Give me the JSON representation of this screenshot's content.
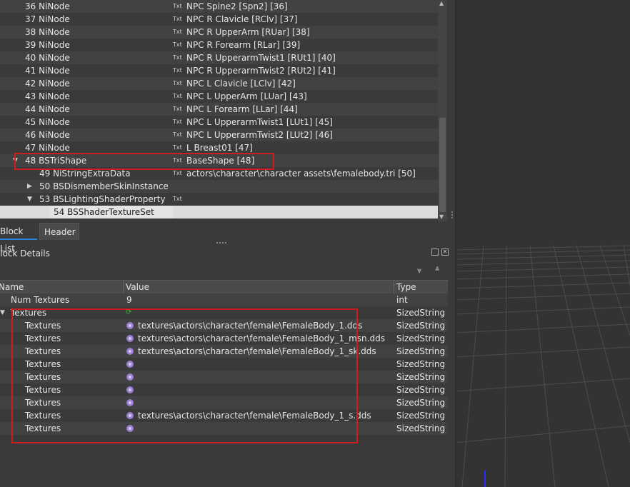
{
  "tree": {
    "rows": [
      {
        "num": "36",
        "type": "NiNode",
        "has_txt": true,
        "value": "NPC Spine2 [Spn2] [36]"
      },
      {
        "num": "37",
        "type": "NiNode",
        "has_txt": true,
        "value": "NPC R Clavicle [RClv] [37]"
      },
      {
        "num": "38",
        "type": "NiNode",
        "has_txt": true,
        "value": "NPC R UpperArm [RUar] [38]"
      },
      {
        "num": "39",
        "type": "NiNode",
        "has_txt": true,
        "value": "NPC R Forearm [RLar] [39]"
      },
      {
        "num": "40",
        "type": "NiNode",
        "has_txt": true,
        "value": "NPC R UpperarmTwist1 [RUt1] [40]"
      },
      {
        "num": "41",
        "type": "NiNode",
        "has_txt": true,
        "value": "NPC R UpperarmTwist2 [RUt2] [41]"
      },
      {
        "num": "42",
        "type": "NiNode",
        "has_txt": true,
        "value": "NPC L Clavicle [LClv] [42]"
      },
      {
        "num": "43",
        "type": "NiNode",
        "has_txt": true,
        "value": "NPC L UpperArm [LUar] [43]"
      },
      {
        "num": "44",
        "type": "NiNode",
        "has_txt": true,
        "value": "NPC L Forearm [LLar] [44]"
      },
      {
        "num": "45",
        "type": "NiNode",
        "has_txt": true,
        "value": "NPC L UpperarmTwist1 [LUt1] [45]"
      },
      {
        "num": "46",
        "type": "NiNode",
        "has_txt": true,
        "value": "NPC L UpperarmTwist2 [LUt2] [46]"
      },
      {
        "num": "47",
        "type": "NiNode",
        "has_txt": true,
        "value": "L Breast01 [47]"
      },
      {
        "num": "48",
        "type": "BSTriShape",
        "has_txt": true,
        "value": "BaseShape [48]"
      },
      {
        "num": "49",
        "type": "NiStringExtraData",
        "has_txt": true,
        "value": "actors\\character\\character assets\\femalebody.tri [50]"
      },
      {
        "num": "50",
        "type": "BSDismemberSkinInstance",
        "has_txt": false,
        "value": ""
      },
      {
        "num": "53",
        "type": "BSLightingShaderProperty",
        "has_txt": true,
        "value": ""
      },
      {
        "num": "54",
        "type": "BSShaderTextureSet",
        "has_txt": false,
        "value": ""
      }
    ],
    "txt_icon": "Txt"
  },
  "tabs": {
    "block_list": "Block List",
    "header": "Header"
  },
  "block_details": {
    "title": "Block Details",
    "columns": {
      "name": "Name",
      "value": "Value",
      "type": "Type"
    },
    "rows": [
      {
        "name": "Num Textures",
        "value": "9",
        "type": "int"
      },
      {
        "name": "Textures",
        "value": "",
        "type": "SizedString"
      },
      {
        "name": "Textures",
        "value": "textures\\actors\\character\\female\\FemaleBody_1.dds",
        "type": "SizedString"
      },
      {
        "name": "Textures",
        "value": "textures\\actors\\character\\female\\FemaleBody_1_msn.dds",
        "type": "SizedString"
      },
      {
        "name": "Textures",
        "value": "textures\\actors\\character\\female\\FemaleBody_1_sk.dds",
        "type": "SizedString"
      },
      {
        "name": "Textures",
        "value": "",
        "type": "SizedString"
      },
      {
        "name": "Textures",
        "value": "",
        "type": "SizedString"
      },
      {
        "name": "Textures",
        "value": "",
        "type": "SizedString"
      },
      {
        "name": "Textures",
        "value": "",
        "type": "SizedString"
      },
      {
        "name": "Textures",
        "value": "textures\\actors\\character\\female\\FemaleBody_1_s.dds",
        "type": "SizedString"
      },
      {
        "name": "Textures",
        "value": "",
        "type": "SizedString"
      }
    ]
  },
  "colors": {
    "highlight_box": "#cc1f1f",
    "axis_blue": "#2030ff",
    "gear": "#9b7fd6"
  }
}
